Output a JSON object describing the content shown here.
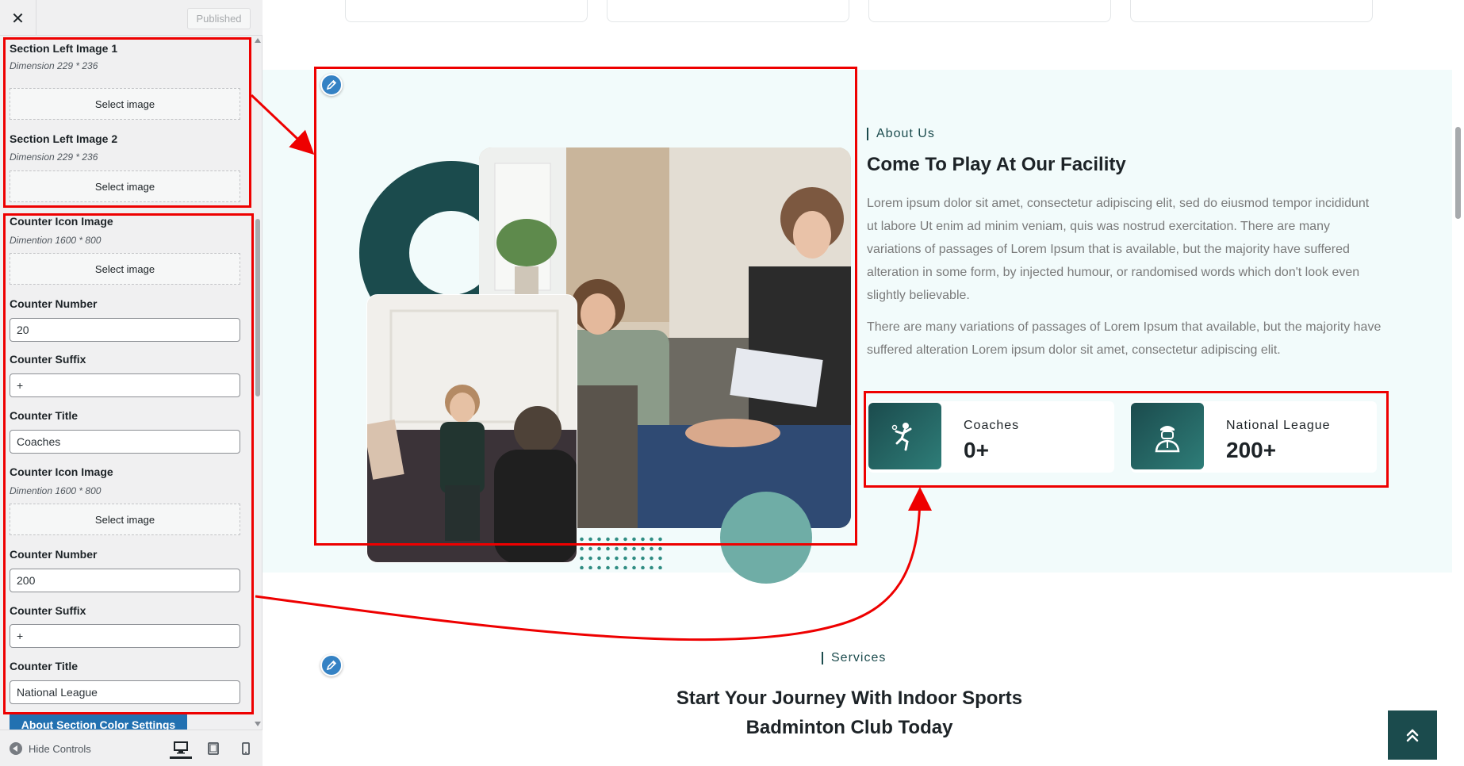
{
  "header": {
    "close_label": "✕",
    "publish_label": "Published"
  },
  "controls": {
    "left_image_1": {
      "label": "Section Left Image 1",
      "desc": "Dimension 229 * 236",
      "button": "Select image"
    },
    "left_image_2": {
      "label": "Section Left Image 2",
      "desc": "Dimension 229 * 236",
      "button": "Select image"
    },
    "counter_1": {
      "icon_label": "Counter Icon Image",
      "icon_desc": "Dimention 1600 * 800",
      "icon_button": "Select image",
      "number_label": "Counter Number",
      "number_value": "20",
      "suffix_label": "Counter Suffix",
      "suffix_value": "+",
      "title_label": "Counter Title",
      "title_value": "Coaches"
    },
    "counter_2": {
      "icon_label": "Counter Icon Image",
      "icon_desc": "Dimention 1600 * 800",
      "icon_button": "Select image",
      "number_label": "Counter Number",
      "number_value": "200",
      "suffix_label": "Counter Suffix",
      "suffix_value": "+",
      "title_label": "Counter Title",
      "title_value": "National League"
    },
    "color_settings_button": "About Section Color Settings"
  },
  "footer": {
    "hide_controls": "Hide Controls",
    "devices": [
      "desktop-icon",
      "tablet-icon",
      "mobile-icon"
    ],
    "active_device": "desktop"
  },
  "about": {
    "kicker": "About Us",
    "title": "Come To Play At Our Facility",
    "para1": "Lorem ipsum dolor sit amet, consectetur adipiscing elit, sed do eiusmod tempor incididunt ut labore Ut enim ad minim veniam, quis was nostrud exercitation. There are many variations of passages of Lorem Ipsum that is available, but the majority have suffered alteration in some form, by injected humour, or randomised words which don't look even slightly believable.",
    "para2": "There are many variations of passages of Lorem Ipsum that available, but the majority have suffered alteration Lorem ipsum dolor sit amet, consectetur adipiscing elit.",
    "counters": [
      {
        "title": "Coaches",
        "value": "0+",
        "icon": "badminton-player-icon"
      },
      {
        "title": "National League",
        "value": "200+",
        "icon": "coach-person-icon"
      }
    ]
  },
  "services": {
    "kicker": "Services",
    "title_line1": "Start Your Journey With Indoor Sports",
    "title_line2": "Badminton Club Today"
  },
  "colors": {
    "brand_dark": "#1b4b4d",
    "brand_teal": "#6fada6",
    "wp_blue": "#2271b1",
    "annotation_red": "#e00000",
    "section_bg": "#f2fbfb"
  }
}
